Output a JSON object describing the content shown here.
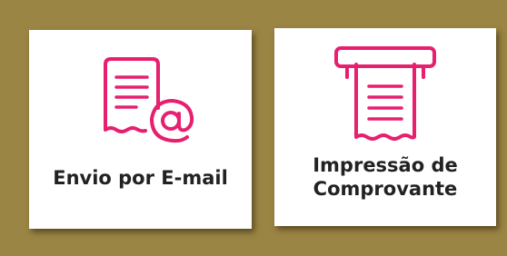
{
  "colors": {
    "background": "#9b8544",
    "card": "#ffffff",
    "accent": "#e6206f",
    "text": "#222222"
  },
  "options": [
    {
      "id": "email",
      "icon": "receipt-email-icon",
      "label": "Envio por E-mail"
    },
    {
      "id": "print",
      "icon": "receipt-printer-icon",
      "label_line1": "Impressão de",
      "label_line2": "Comprovante"
    }
  ]
}
